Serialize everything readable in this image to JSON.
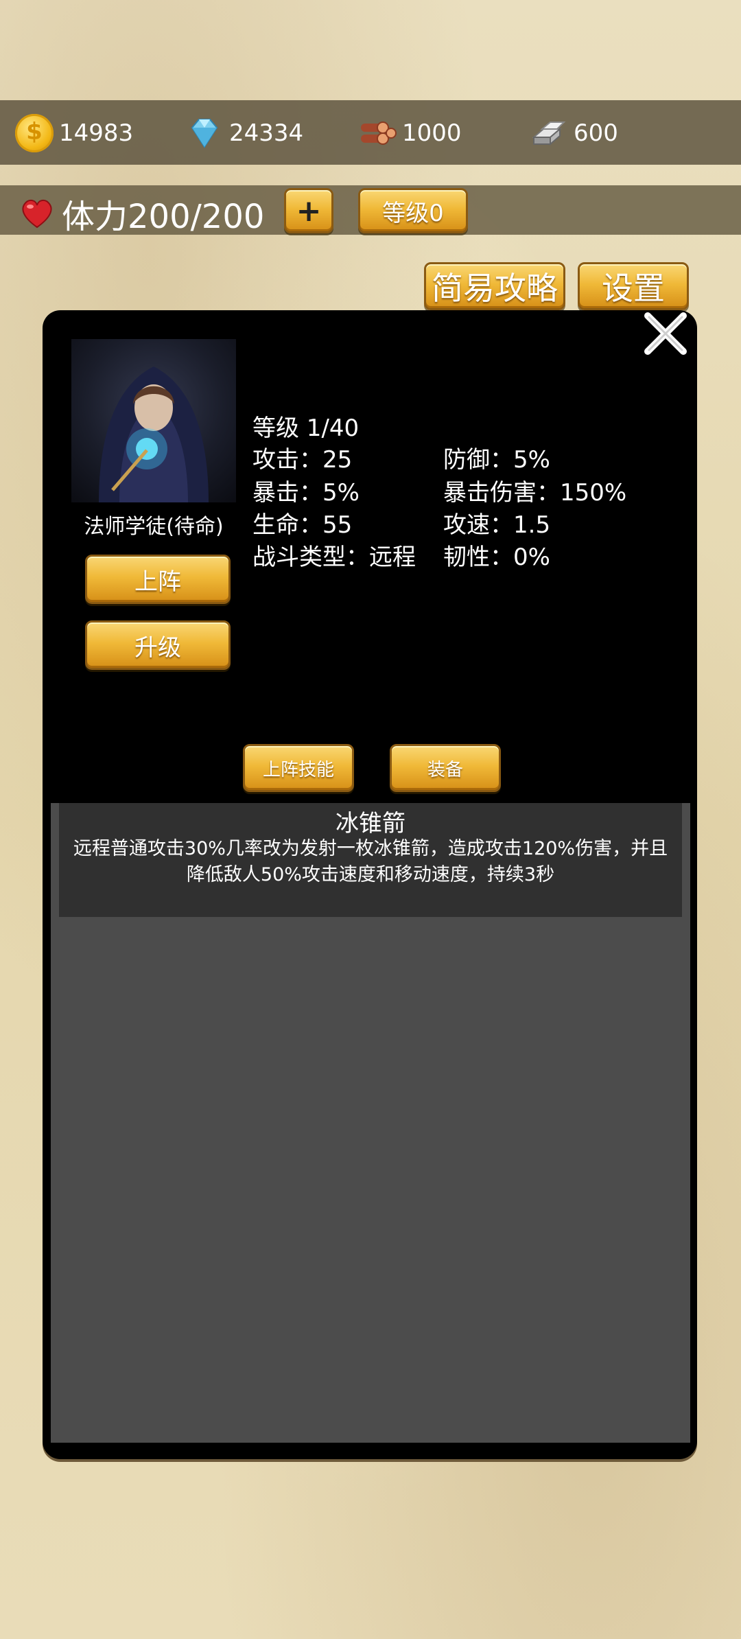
{
  "resources": {
    "gold": "14983",
    "diamond": "24334",
    "wood": "1000",
    "iron": "600"
  },
  "stamina": {
    "text": "体力200/200",
    "add_label": "+",
    "level_label": "等级0"
  },
  "top_buttons": {
    "guide_label": "简易攻略",
    "settings_label": "设置"
  },
  "hero": {
    "name": "法师学徒(待命)",
    "deploy_label": "上阵",
    "upgrade_label": "升级",
    "stats": {
      "level": "等级 1/40",
      "attack": "攻击：25",
      "defense": "防御：5%",
      "crit": "暴击：5%",
      "crit_damage": "暴击伤害：150%",
      "hp": "生命：55",
      "attack_speed": "攻速：1.5",
      "combat_type": "战斗类型：远程",
      "toughness": "韧性：0%"
    }
  },
  "tabs": {
    "skills_label": "上阵技能",
    "equipment_label": "装备"
  },
  "skill": {
    "name": "冰锥箭",
    "description": "远程普通攻击30%几率改为发射一枚冰锥箭，造成攻击120%伤害，并且降低敌人50%攻击速度和移动速度，持续3秒"
  },
  "colors": {
    "gold_button": "#f0b938",
    "panel_bg": "#000000",
    "skill_panel_bg": "#4c4c4c"
  }
}
